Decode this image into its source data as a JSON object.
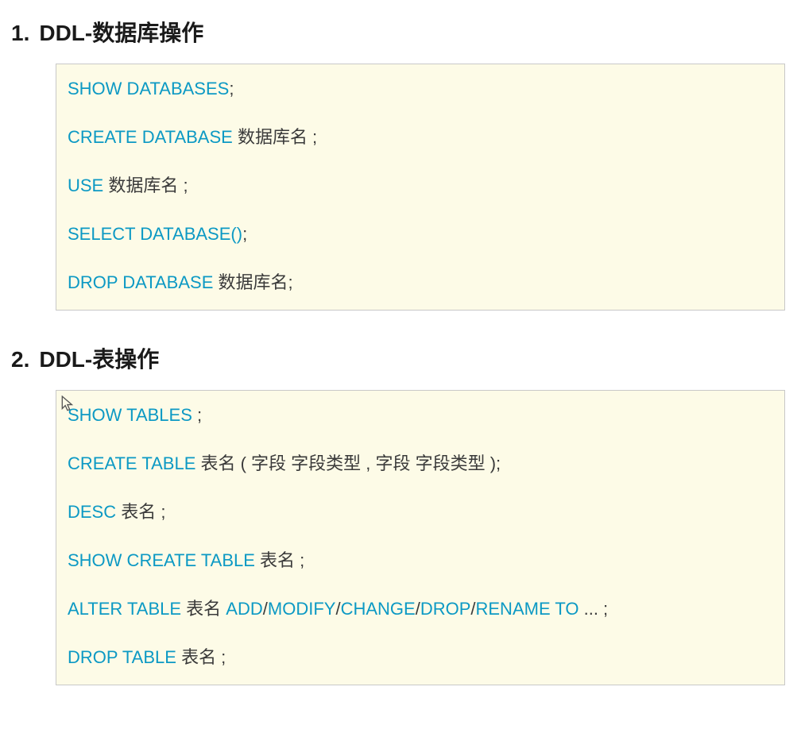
{
  "sections": [
    {
      "number": "1.",
      "title": "DDL-数据库操作",
      "lines": [
        {
          "tokens": [
            {
              "k": "kw",
              "t": "SHOW DATABASES"
            },
            {
              "k": "txt",
              "t": ";"
            }
          ]
        },
        {
          "tokens": [
            {
              "k": "kw",
              "t": "CREATE  DATABASE"
            },
            {
              "k": "txt",
              "t": "  数据库名 ;"
            }
          ]
        },
        {
          "tokens": [
            {
              "k": "kw",
              "t": "USE"
            },
            {
              "k": "txt",
              "t": "  数据库名 ;"
            }
          ]
        },
        {
          "tokens": [
            {
              "k": "kw",
              "t": "SELECT  DATABASE()"
            },
            {
              "k": "txt",
              "t": ";"
            }
          ]
        },
        {
          "tokens": [
            {
              "k": "kw",
              "t": "DROP  DATABASE"
            },
            {
              "k": "txt",
              "t": "  数据库名;"
            }
          ]
        }
      ],
      "cursor": false
    },
    {
      "number": "2.",
      "title": "DDL-表操作",
      "lines": [
        {
          "tokens": [
            {
              "k": "kw",
              "t": "SHOW  TABLES"
            },
            {
              "k": "txt",
              "t": " ;"
            }
          ]
        },
        {
          "tokens": [
            {
              "k": "kw",
              "t": "CREATE  TABLE"
            },
            {
              "k": "txt",
              "t": "  表名 ( 字段  字段类型 , 字段  字段类型 );"
            }
          ]
        },
        {
          "tokens": [
            {
              "k": "kw",
              "t": "DESC"
            },
            {
              "k": "txt",
              "t": "  表名 ;"
            }
          ]
        },
        {
          "tokens": [
            {
              "k": "kw",
              "t": "SHOW  CREATE  TABLE"
            },
            {
              "k": "txt",
              "t": "  表名 ;"
            }
          ]
        },
        {
          "tokens": [
            {
              "k": "kw",
              "t": "ALTER  TABLE"
            },
            {
              "k": "txt",
              "t": "  表名  "
            },
            {
              "k": "kw",
              "t": "ADD"
            },
            {
              "k": "txt",
              "t": "/"
            },
            {
              "k": "kw",
              "t": "MODIFY"
            },
            {
              "k": "txt",
              "t": "/"
            },
            {
              "k": "kw",
              "t": "CHANGE"
            },
            {
              "k": "txt",
              "t": "/"
            },
            {
              "k": "kw",
              "t": "DROP"
            },
            {
              "k": "txt",
              "t": "/"
            },
            {
              "k": "kw",
              "t": "RENAME TO"
            },
            {
              "k": "txt",
              "t": " ... ;"
            }
          ]
        },
        {
          "tokens": [
            {
              "k": "kw",
              "t": "DROP  TABLE"
            },
            {
              "k": "txt",
              "t": "  表名 ;"
            }
          ]
        }
      ],
      "cursor": true
    }
  ]
}
